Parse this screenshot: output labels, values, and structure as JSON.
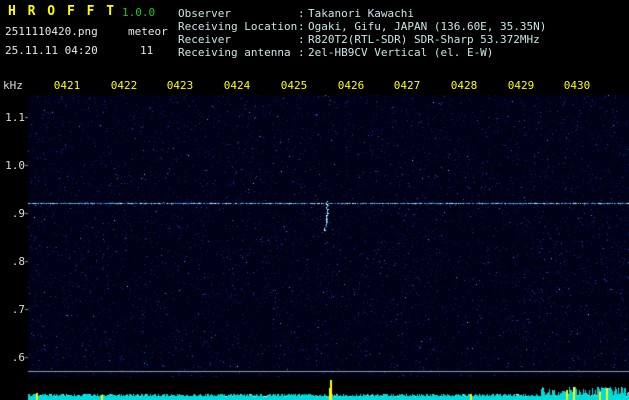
{
  "app": {
    "title": "H R O F F T",
    "version": "1.0.0",
    "filename": "2511110420.png",
    "mode_label": "meteor",
    "meteor_count": "11",
    "timestamp": "25.11.11 04:20"
  },
  "info": {
    "separator": ":",
    "rows": [
      {
        "label": "Observer",
        "value": "Takanori Kawachi"
      },
      {
        "label": "Receiving Location",
        "value": "Ogaki, Gifu, JAPAN (136.60E, 35.35N)"
      },
      {
        "label": "Receiver",
        "value": "R820T2(RTL-SDR) SDR-Sharp 53.372MHz"
      },
      {
        "label": "Receiving antenna",
        "value": "2el-HB9CV Vertical (el. E-W)"
      }
    ]
  },
  "colors": {
    "title": "#ffff00",
    "version": "#18c818",
    "time_ticks": "#ffff00",
    "freq_ticks": "#dcdcdc",
    "band": "#00dcdc",
    "spike": "#ffff00",
    "carrier": "#9fe8ff",
    "plot_bg": "#000016"
  },
  "chart_data": {
    "type": "heatmap",
    "title": "HROFFT radio meteor spectrogram 25.11.11 04:20-04:30",
    "ylabel": "kHz",
    "xlabel": "",
    "x_ticks": [
      "0421",
      "0422",
      "0423",
      "0424",
      "0425",
      "0426",
      "0427",
      "0428",
      "0429",
      "0430"
    ],
    "y_ticks": [
      "1.1",
      "1.0",
      ".9",
      ".8",
      ".7",
      ".6"
    ],
    "y_tick_khz": [
      1.1,
      1.0,
      0.9,
      0.8,
      0.7,
      0.6
    ],
    "y_range_khz": [
      0.56,
      1.15
    ],
    "x_range_time": [
      "0420",
      "0430"
    ],
    "carrier_line_khz": 0.92,
    "echoes": [
      {
        "t": 425.6,
        "khz_from": 0.865,
        "khz_to": 0.925
      }
    ],
    "band": {
      "baseline_level": 5,
      "noisy_from_t": 429.35,
      "spikes": [
        {
          "t": 420.45,
          "h": 7
        },
        {
          "t": 421.6,
          "h": 5
        },
        {
          "t": 425.63,
          "h": 20
        },
        {
          "t": 428.1,
          "h": 6
        },
        {
          "t": 429.8,
          "h": 10
        },
        {
          "t": 429.93,
          "h": 13
        },
        {
          "t": 430.38,
          "h": 8
        },
        {
          "t": 430.5,
          "h": 12
        }
      ]
    }
  }
}
